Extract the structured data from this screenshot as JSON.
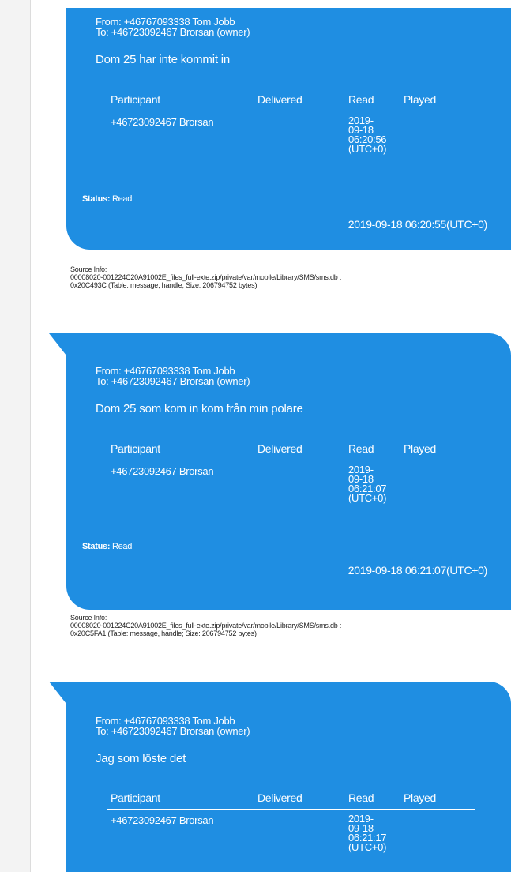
{
  "messages": [
    {
      "from": "From: +46767093338 Tom Jobb",
      "to": "To: +46723092467 Brorsan (owner)",
      "text": "Dom 25 har inte kommit in",
      "table_headers": [
        "Participant",
        "Delivered",
        "Read",
        "Played"
      ],
      "participant": "+46723092467 Brorsan",
      "delivered": "",
      "read": "2019-\n09-18\n06:20:56\n(UTC+0)",
      "played": "",
      "status_label": "Status:",
      "status_value": "Read",
      "timestamp": "2019-09-18 06:20:55(UTC+0)",
      "source_label": "Source Info:",
      "source_line1": "00008020-001224C20A91002E_files_full-exte.zip/private/var/mobile/Library/SMS/sms.db :",
      "source_line2": "0x20C493C (Table: message, handle; Size: 206794752 bytes)"
    },
    {
      "from": "From: +46767093338 Tom Jobb",
      "to": "To: +46723092467 Brorsan (owner)",
      "text": "Dom 25 som kom in kom från min polare",
      "table_headers": [
        "Participant",
        "Delivered",
        "Read",
        "Played"
      ],
      "participant": "+46723092467 Brorsan",
      "delivered": "",
      "read": "2019-\n09-18\n06:21:07\n(UTC+0)",
      "played": "",
      "status_label": "Status:",
      "status_value": "Read",
      "timestamp": "2019-09-18 06:21:07(UTC+0)",
      "source_label": "Source Info:",
      "source_line1": "00008020-001224C20A91002E_files_full-exte.zip/private/var/mobile/Library/SMS/sms.db :",
      "source_line2": "0x20C5FA1 (Table: message, handle; Size: 206794752 bytes)"
    },
    {
      "from": "From: +46767093338 Tom Jobb",
      "to": "To: +46723092467 Brorsan (owner)",
      "text": "Jag som löste det",
      "table_headers": [
        "Participant",
        "Delivered",
        "Read",
        "Played"
      ],
      "participant": "+46723092467 Brorsan",
      "delivered": "",
      "read": "2019-\n09-18\n06:21:17\n(UTC+0)",
      "played": ""
    }
  ],
  "colors": {
    "bubble": "#1f8ee2",
    "rail": "#f3f3f3"
  }
}
